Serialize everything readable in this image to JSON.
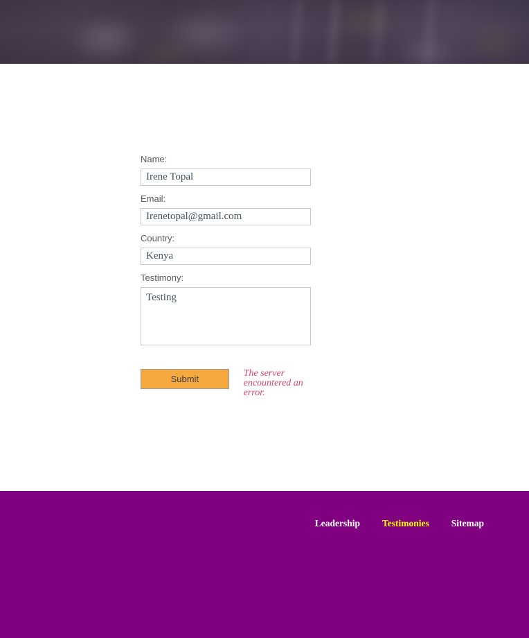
{
  "hero": {
    "alt": "blurred dark purple photographic banner",
    "base_color": "#4b4050"
  },
  "form": {
    "fields": [
      {
        "label": "Name:",
        "value": "Irene Topal",
        "name": "name"
      },
      {
        "label": "Email:",
        "value": "Irenetopal@gmail.com",
        "name": "email"
      },
      {
        "label": "Country:",
        "value": "Kenya",
        "name": "country"
      },
      {
        "label": "Testimony:",
        "value": "Testing",
        "name": "testimony"
      }
    ],
    "submit_label": "Submit",
    "error_message": "The server encountered an error.",
    "error_color": "#d6456b",
    "submit_color": "#f5a93f"
  },
  "footer": {
    "background": "#800080",
    "active_color": "#ffff00",
    "links": [
      {
        "label": "Leadership",
        "active": false
      },
      {
        "label": "Testimonies",
        "active": true
      },
      {
        "label": "Sitemap",
        "active": false
      }
    ]
  }
}
